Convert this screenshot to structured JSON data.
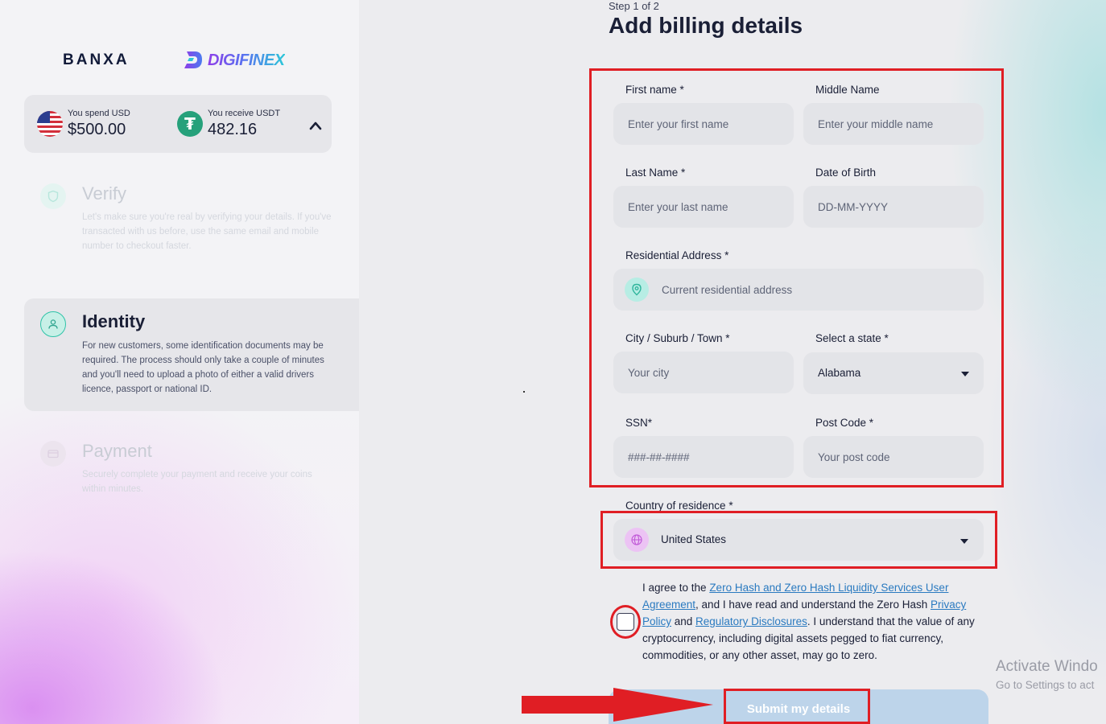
{
  "brand": {
    "banxa": "BANXA",
    "digifinex": "DIGIFINEX"
  },
  "summary": {
    "spend_label": "You spend USD",
    "spend_value": "$500.00",
    "receive_label": "You receive USDT",
    "receive_value": "482.16",
    "usdt_glyph": "₮"
  },
  "steps": [
    {
      "title": "Verify",
      "description": "Let's make sure you're real by verifying your details. If you've transacted with us before, use the same email and mobile number to checkout faster.",
      "state": "faded"
    },
    {
      "title": "Identity",
      "description": "For new customers, some identification documents may be required. The process should only take a couple of minutes and you'll need to upload a photo of either a valid drivers licence, passport or national ID.",
      "state": "active"
    },
    {
      "title": "Payment",
      "description": "Securely complete your payment and receive your coins within minutes.",
      "state": "faded"
    }
  ],
  "form": {
    "step_counter": "Step 1 of 2",
    "title": "Add billing details",
    "first_name": {
      "label": "First name *",
      "placeholder": "Enter your first name"
    },
    "middle_name": {
      "label": "Middle Name",
      "placeholder": "Enter your middle name"
    },
    "last_name": {
      "label": "Last Name *",
      "placeholder": "Enter your last name"
    },
    "dob": {
      "label": "Date of Birth",
      "placeholder": "DD-MM-YYYY"
    },
    "address": {
      "label": "Residential Address *",
      "placeholder": "Current residential address"
    },
    "city": {
      "label": "City / Suburb / Town *",
      "placeholder": "Your city"
    },
    "state": {
      "label": "Select a state *",
      "value": "Alabama"
    },
    "ssn": {
      "label": "SSN*",
      "placeholder": "###-##-####"
    },
    "post_code": {
      "label": "Post Code *",
      "placeholder": "Your post code"
    },
    "country": {
      "label": "Country of residence *",
      "value": "United States"
    },
    "agreement": {
      "t1": "I agree to the ",
      "link1": "Zero Hash and Zero Hash Liquidity Services User Agreement",
      "t2": ", and I have read and understand the Zero Hash ",
      "link2": "Privacy Policy",
      "t3": " and ",
      "link3": "Regulatory Disclosures",
      "t4": ". I understand that the value of any cryptocurrency, including digital assets pegged to fiat currency, commodities, or any other asset, may go to zero."
    },
    "submit_label": "Submit my details"
  },
  "watermark": {
    "line1": "Activate Windo",
    "line2": "Go to Settings to act"
  },
  "colors": {
    "annotation_red": "#e01e24",
    "link": "#2a7ac0",
    "active_step_icon": "#2fc3a8",
    "submit_disabled": "#bdd4ea"
  }
}
